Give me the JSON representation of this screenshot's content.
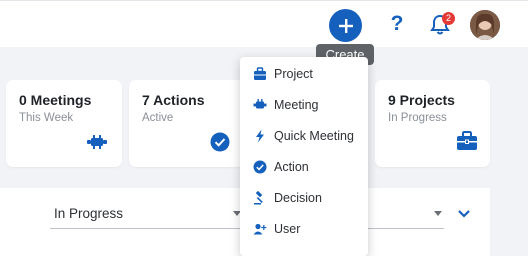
{
  "header": {
    "create_label": "Create",
    "notification_count": "2",
    "help_label": "?"
  },
  "cards": [
    {
      "title": "0 Meetings",
      "subtitle": "This Week",
      "icon": "meeting-icon"
    },
    {
      "title": "7 Actions",
      "subtitle": "Active",
      "icon": "check-circle-icon"
    },
    {
      "title": "9 Projects",
      "subtitle": "In Progress",
      "icon": "briefcase-icon"
    }
  ],
  "create_menu": {
    "items": [
      {
        "label": "Project",
        "icon": "briefcase-icon"
      },
      {
        "label": "Meeting",
        "icon": "meeting-icon"
      },
      {
        "label": "Quick Meeting",
        "icon": "lightning-icon"
      },
      {
        "label": "Action",
        "icon": "check-circle-icon"
      },
      {
        "label": "Decision",
        "icon": "gavel-icon"
      },
      {
        "label": "User",
        "icon": "add-user-icon"
      }
    ]
  },
  "filters": {
    "status_value": "In Progress"
  },
  "colors": {
    "accent": "#1560bd",
    "badge": "#e53935",
    "tooltip": "#5f6368",
    "background": "#f2f3f6"
  }
}
